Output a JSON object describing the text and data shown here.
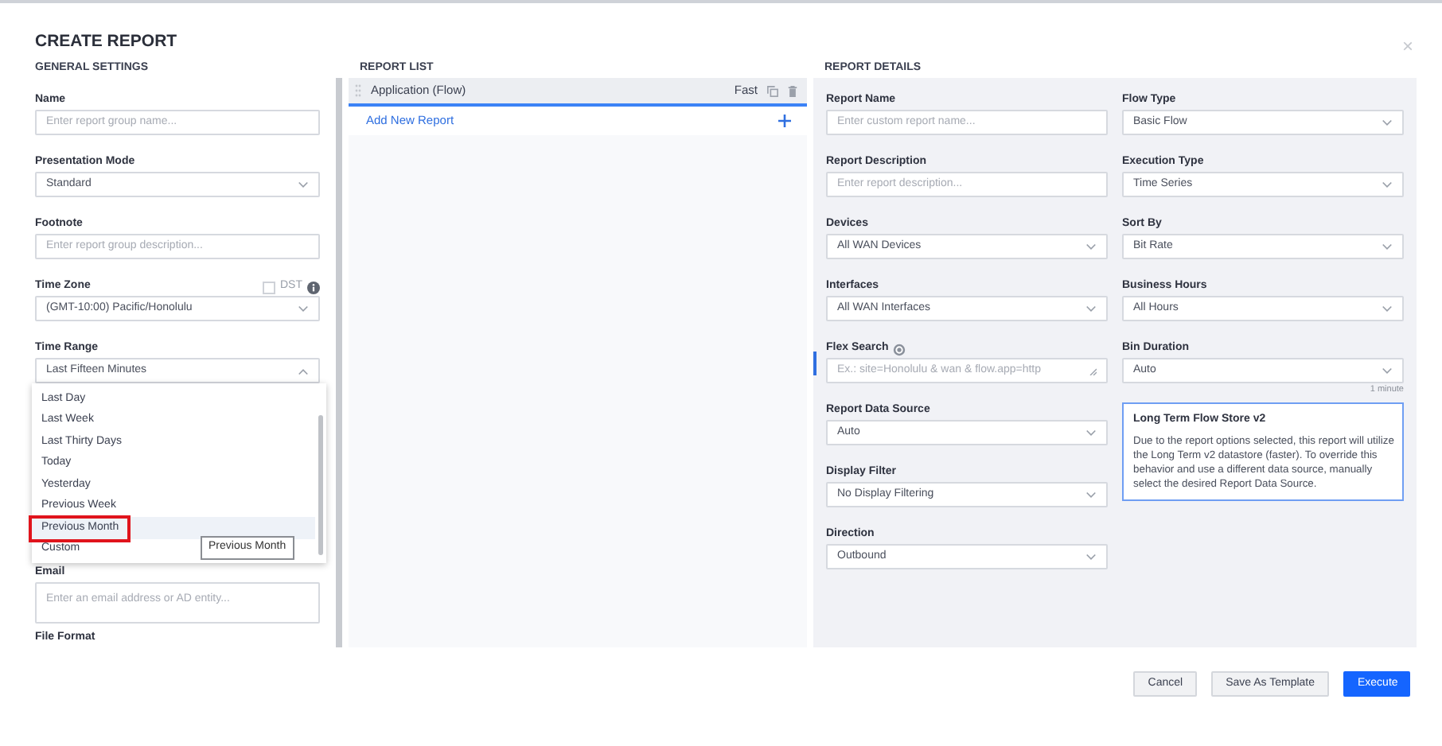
{
  "title": "CREATE REPORT",
  "close_label": "×",
  "general_settings": {
    "heading": "GENERAL SETTINGS",
    "fields": [
      {
        "label": "Name",
        "kind": "text",
        "placeholder": "Enter report group name..."
      },
      {
        "label": "Presentation Mode",
        "kind": "select",
        "value": "Standard"
      },
      {
        "label": "Footnote",
        "kind": "text",
        "placeholder": "Enter report group description..."
      },
      {
        "label": "Time Zone",
        "kind": "select",
        "value": "(GMT-10:00) Pacific/Honolulu",
        "dst": {
          "label": "DST",
          "checked": false
        }
      },
      {
        "label": "Time Range",
        "kind": "select",
        "value": "Last Fifteen Minutes",
        "expanded": true,
        "options": [
          {
            "label": "Last Day",
            "highlighted": false
          },
          {
            "label": "Last Week",
            "highlighted": false
          },
          {
            "label": "Last Thirty Days",
            "highlighted": false
          },
          {
            "label": "Today",
            "highlighted": false
          },
          {
            "label": "Yesterday",
            "highlighted": false
          },
          {
            "label": "Previous Week",
            "highlighted": false
          },
          {
            "label": "Previous Month",
            "highlighted": true
          },
          {
            "label": "Custom",
            "highlighted": false
          }
        ],
        "tooltip": "Previous Month"
      },
      {
        "label": "Email",
        "kind": "textarea",
        "placeholder": "Enter an email address or AD entity..."
      },
      {
        "label": "File Format",
        "kind": "label"
      }
    ]
  },
  "report_list": {
    "heading": "REPORT LIST",
    "reports": [
      {
        "name": "Application (Flow)",
        "speed": "Fast",
        "selected": true
      }
    ],
    "add_label": "Add New Report"
  },
  "report_details": {
    "heading": "REPORT DETAILS",
    "columns": [
      [
        {
          "label": "Report Name",
          "kind": "text",
          "placeholder": "Enter custom report name..."
        },
        {
          "label": "Report Description",
          "kind": "text",
          "placeholder": "Enter report description..."
        },
        {
          "label": "Devices",
          "kind": "select",
          "value": "All WAN Devices"
        },
        {
          "label": "Interfaces",
          "kind": "select",
          "value": "All WAN Interfaces"
        },
        {
          "label": "Flex Search",
          "kind": "textarea",
          "placeholder": "Ex.: site=Honolulu & wan & flow.app=http",
          "help": true
        },
        {
          "label": "Report Data Source",
          "kind": "select",
          "value": "Auto"
        },
        {
          "label": "Display Filter",
          "kind": "select",
          "value": "No Display Filtering"
        },
        {
          "label": "Direction",
          "kind": "select",
          "value": "Outbound"
        }
      ],
      [
        {
          "label": "Flow Type",
          "kind": "select",
          "value": "Basic Flow"
        },
        {
          "label": "Execution Type",
          "kind": "select",
          "value": "Time Series"
        },
        {
          "label": "Sort By",
          "kind": "select",
          "value": "Bit Rate"
        },
        {
          "label": "Business Hours",
          "kind": "select",
          "value": "All Hours"
        },
        {
          "label": "Bin Duration",
          "kind": "select",
          "value": "Auto",
          "hint": "1 minute"
        },
        {
          "kind": "info",
          "title": "Long Term Flow Store v2",
          "text": "Due to the report options selected, this report will utilize the Long Term v2 datastore (faster). To override this behavior and use a different data source, manually select the desired Report Data Source."
        }
      ]
    ]
  },
  "buttons": [
    {
      "label": "Cancel",
      "kind": "secondary"
    },
    {
      "label": "Save As Template",
      "kind": "secondary"
    },
    {
      "label": "Execute",
      "kind": "primary"
    }
  ]
}
